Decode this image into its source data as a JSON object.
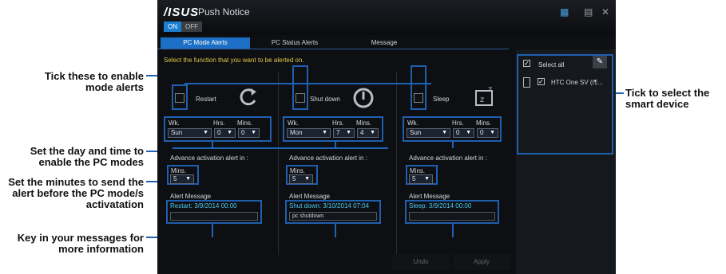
{
  "callouts": {
    "tick_mode": "Tick these to enable mode alerts",
    "set_day": "Set the day and time to enable the PC modes",
    "set_minutes": "Set the minutes to send the alert before the PC mode/s activatation",
    "key_messages": "Key in your messages for more information",
    "tick_device": "Tick to select the smart device"
  },
  "app": {
    "logo": "/ISUS",
    "title": "Push Notice",
    "toggle_on": "ON",
    "toggle_off": "OFF"
  },
  "tabs": [
    {
      "label": "PC Mode Alerts",
      "active": true
    },
    {
      "label": "PC Status Alerts",
      "active": false
    },
    {
      "label": "Message",
      "active": false
    }
  ],
  "instruction": "Select the function that you want to be alerted on.",
  "schedule_labels": {
    "week": "Wk.",
    "hours": "Hrs.",
    "minutes": "Mins."
  },
  "advance_label": "Advance activation alert in :",
  "alert_message_label": "Alert Message",
  "modes": [
    {
      "name": "Restart",
      "icon": "restart-icon",
      "week": "Sun",
      "hours": "0",
      "minutes": "0",
      "advance_label": "Mins.",
      "advance": "5",
      "message_status": "Restart: 3/9/2014 00:00",
      "message_text": ""
    },
    {
      "name": "Shut down",
      "icon": "power-icon",
      "week": "Mon",
      "hours": "7",
      "minutes": "4",
      "advance_label": "Mins.",
      "advance": "5",
      "message_status": "Shut down: 3/10/2014 07:04",
      "message_text": "pc shutdown"
    },
    {
      "name": "Sleep",
      "icon": "sleep-icon",
      "week": "Sun",
      "hours": "0",
      "minutes": "0",
      "advance_label": "Mins.",
      "advance": "5",
      "message_status": "Sleep: 3/9/2014 00:00",
      "message_text": ""
    }
  ],
  "devices": {
    "select_all": "Select all",
    "items": [
      {
        "name": "HTC One SV (I¶..."
      }
    ]
  },
  "buttons": {
    "undo": "Undo",
    "apply": "Apply"
  },
  "colors": {
    "accent": "#1f62b5",
    "background": "#0d0f12",
    "message_text": "#4ec9f0",
    "instruction_text": "#e0c84a"
  }
}
